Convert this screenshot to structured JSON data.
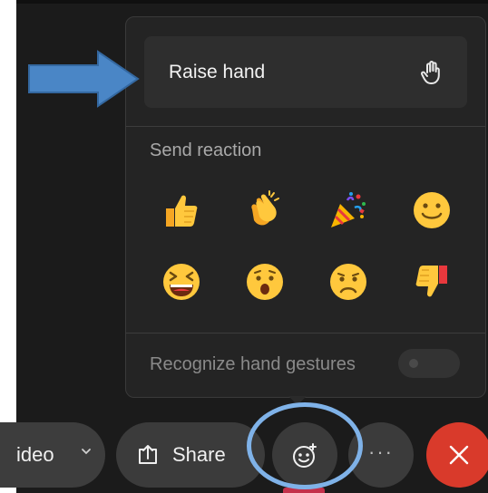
{
  "reactions_menu": {
    "raise_hand_label": "Raise hand",
    "raise_hand_icon": "hand-icon",
    "send_reaction_label": "Send reaction",
    "reactions": [
      {
        "name": "like",
        "icon": "thumbs-up-icon"
      },
      {
        "name": "applause",
        "icon": "clapping-hands-icon"
      },
      {
        "name": "celebrate",
        "icon": "party-popper-icon"
      },
      {
        "name": "smile",
        "icon": "smiley-icon"
      },
      {
        "name": "laugh",
        "icon": "laughing-face-icon"
      },
      {
        "name": "surprised",
        "icon": "surprised-face-icon"
      },
      {
        "name": "sad",
        "icon": "sad-face-icon"
      },
      {
        "name": "dislike",
        "icon": "thumbs-down-icon"
      }
    ],
    "hand_gestures_label": "Recognize hand gestures",
    "hand_gestures_enabled": false
  },
  "toolbar": {
    "video_label": "ideo",
    "share_label": "Share",
    "more_label": "···",
    "react_icon": "react-icon",
    "leave_icon": "close-icon"
  },
  "colors": {
    "arrow": "#4a86c6",
    "highlight_ring": "#7fb2e8",
    "leave": "#d93a2b",
    "active_indicator": "#c4314b"
  }
}
